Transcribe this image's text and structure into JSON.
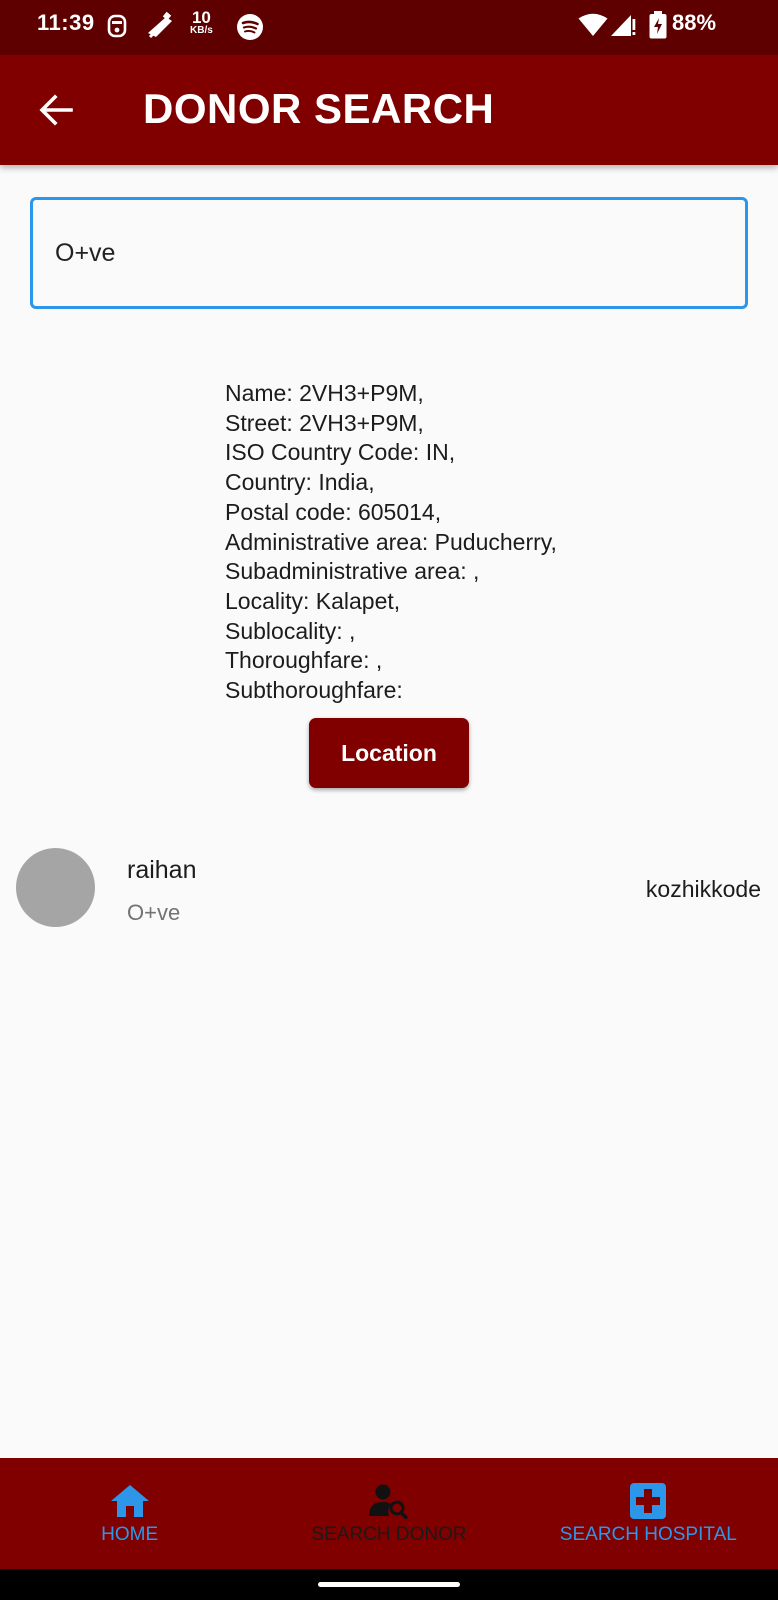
{
  "status_bar": {
    "time": "11:39",
    "speed_value": "10",
    "speed_unit": "KB/s",
    "battery": "88%"
  },
  "app_bar": {
    "title": "DONOR SEARCH"
  },
  "search": {
    "value": "O+ve"
  },
  "address": {
    "lines": [
      "Name: 2VH3+P9M,",
      "Street: 2VH3+P9M,",
      "ISO Country Code: IN,",
      "Country: India,",
      "Postal code: 605014,",
      "Administrative area: Puducherry,",
      "Subadministrative area: ,",
      "Locality: Kalapet,",
      "Sublocality: ,",
      "Thoroughfare: ,",
      "Subthoroughfare:"
    ]
  },
  "location_button": {
    "label": "Location"
  },
  "donors": [
    {
      "name": "raihan",
      "blood_group": "O+ve",
      "city": "kozhikkode"
    }
  ],
  "bottom_nav": {
    "items": [
      {
        "label": "HOME",
        "icon": "home-icon",
        "color": "#2e96e8"
      },
      {
        "label": "SEARCH DONOR",
        "icon": "person-search-icon",
        "color": "#1a1a1a"
      },
      {
        "label": "SEARCH HOSPITAL",
        "icon": "hospital-cross-icon",
        "color": "#2e96e8"
      }
    ]
  },
  "colors": {
    "status_bar": "#5e0000",
    "primary": "#800000",
    "accent": "#2e96e8",
    "background": "#fafafa"
  }
}
